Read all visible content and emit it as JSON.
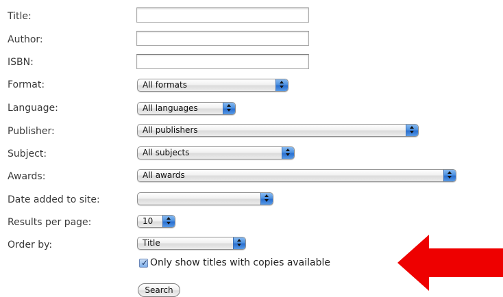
{
  "form": {
    "title_label": "Title:",
    "title_value": "",
    "author_label": "Author:",
    "author_value": "",
    "isbn_label": "ISBN:",
    "isbn_value": "",
    "format_label": "Format:",
    "format_value": "All formats",
    "language_label": "Language:",
    "language_value": "All languages",
    "publisher_label": "Publisher:",
    "publisher_value": "All publishers",
    "subject_label": "Subject:",
    "subject_value": "All subjects",
    "awards_label": "Awards:",
    "awards_value": "All awards",
    "date_label": "Date added to site:",
    "date_value": "",
    "results_label": "Results per page:",
    "results_value": "10",
    "order_label": "Order by:",
    "order_value": "Title",
    "availability_checked": true,
    "availability_label": "Only show titles with copies available",
    "search_label": "Search"
  },
  "colors": {
    "select_arrow": "#2a6fd0",
    "annotation_arrow": "#ee0000"
  },
  "icons": {
    "select_arrow": "up-down-chevron-icon",
    "checkbox_tick": "checkmark-icon",
    "annotation": "red-arrow-left-icon"
  }
}
